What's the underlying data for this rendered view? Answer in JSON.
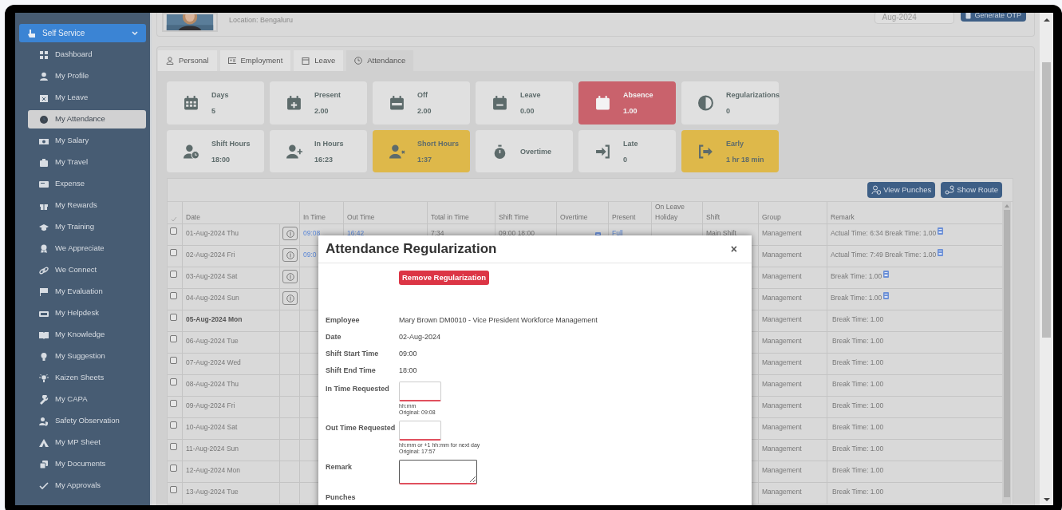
{
  "sidebar": {
    "section": {
      "label": "Self Service",
      "expanded": true
    },
    "items": [
      {
        "label": "Dashboard",
        "selected": false
      },
      {
        "label": "My Profile",
        "selected": false
      },
      {
        "label": "My Leave",
        "selected": false
      },
      {
        "label": "My Attendance",
        "selected": true
      },
      {
        "label": "My Salary",
        "selected": false
      },
      {
        "label": "My Travel",
        "selected": false
      },
      {
        "label": "Expense",
        "selected": false
      },
      {
        "label": "My Rewards",
        "selected": false
      },
      {
        "label": "My Training",
        "selected": false
      },
      {
        "label": "We Appreciate",
        "selected": false
      },
      {
        "label": "We Connect",
        "selected": false
      },
      {
        "label": "My Evaluation",
        "selected": false
      },
      {
        "label": "My Helpdesk",
        "selected": false
      },
      {
        "label": "My Knowledge",
        "selected": false
      },
      {
        "label": "My Suggestion",
        "selected": false
      },
      {
        "label": "Kaizen Sheets",
        "selected": false
      },
      {
        "label": "My CAPA",
        "selected": false
      },
      {
        "label": "Safety Observation",
        "selected": false
      },
      {
        "label": "My MP Sheet",
        "selected": false
      },
      {
        "label": "My Documents",
        "selected": false
      },
      {
        "label": "My Approvals",
        "selected": false
      }
    ]
  },
  "profile": {
    "location": "Location: Bengaluru",
    "month": "Aug-2024",
    "otp_button": "Generate OTP"
  },
  "tabs": [
    {
      "label": "Personal",
      "selected": false
    },
    {
      "label": "Employment",
      "selected": false
    },
    {
      "label": "Leave",
      "selected": false
    },
    {
      "label": "Attendance",
      "selected": true
    }
  ],
  "stats": [
    {
      "label": "Days",
      "value": "5",
      "color": "#e0e0e0"
    },
    {
      "label": "Present",
      "value": "2.00",
      "color": "#e0e0e0"
    },
    {
      "label": "Off",
      "value": "2.00",
      "color": "#e0e0e0"
    },
    {
      "label": "Leave",
      "value": "0.00",
      "color": "#e0e0e0"
    },
    {
      "label": "Absence",
      "value": "1.00",
      "color": "#c9626c"
    },
    {
      "label": "Regularizations",
      "value": "0",
      "color": "#e0e0e0"
    },
    {
      "label": "Shift Hours",
      "value": "18:00",
      "color": "#e0e0e0"
    },
    {
      "label": "In Hours",
      "value": "16:23",
      "color": "#e0e0e0"
    },
    {
      "label": "Short Hours",
      "value": "1:37",
      "color": "#deb84a"
    },
    {
      "label": "Overtime",
      "color": "#e0e0e0"
    },
    {
      "label": "Late",
      "value": "0",
      "color": "#e0e0e0"
    },
    {
      "label": "Early",
      "value": "1 hr 18 min",
      "color": "#deb84a"
    }
  ],
  "toolbar": [
    "View Punches",
    "Show Route"
  ],
  "table": {
    "columns": [
      "Date",
      "In Time",
      "Out Time",
      "Total in Time",
      "Shift Time",
      "Overtime",
      "Present",
      "On Leave Holiday",
      "Shift",
      "Group",
      "Remark"
    ],
    "rows": [
      {
        "checked": false,
        "date": "01-Aug-2024 Thu",
        "bold": false,
        "info": true,
        "in_time": "09:08",
        "out_time": "16:42",
        "total": "7:34",
        "shift_time": "09:00 18:00",
        "overtime_icon": true,
        "present": "Full",
        "shift": "Main Shift",
        "group": "Management",
        "remark": "Actual Time: 6:34 Break Time: 1.00",
        "remark_icon": true
      },
      {
        "checked": false,
        "date": "02-Aug-2024 Fri",
        "bold": false,
        "info": true,
        "in_time": "09:0",
        "group": "Management",
        "remark": "Actual Time: 7:49 Break Time: 1.00",
        "remark_icon": true
      },
      {
        "checked": false,
        "date": "03-Aug-2024 Sat",
        "bold": false,
        "info": true,
        "group": "Management",
        "remark": "Break Time: 1.00",
        "remark_icon": true
      },
      {
        "checked": false,
        "date": "04-Aug-2024 Sun",
        "bold": false,
        "info": true,
        "group": "Management",
        "remark": "Break Time: 1.00",
        "remark_icon": true
      },
      {
        "checked": false,
        "date": "05-Aug-2024 Mon",
        "bold": true,
        "info": false,
        "group": "Management",
        "remark": "Break Time: 1.00",
        "remark_icon": false
      },
      {
        "checked": false,
        "date": "06-Aug-2024 Tue",
        "bold": false,
        "info": false,
        "group": "Management",
        "remark": "Break Time: 1.00",
        "remark_icon": false
      },
      {
        "checked": false,
        "date": "07-Aug-2024 Wed",
        "bold": false,
        "info": false,
        "group": "Management",
        "remark": "Break Time: 1.00",
        "remark_icon": false
      },
      {
        "checked": false,
        "date": "08-Aug-2024 Thu",
        "bold": false,
        "info": false,
        "group": "Management",
        "remark": "Break Time: 1.00",
        "remark_icon": false
      },
      {
        "checked": false,
        "date": "09-Aug-2024 Fri",
        "bold": false,
        "info": false,
        "group": "Management",
        "remark": "Break Time: 1.00",
        "remark_icon": false
      },
      {
        "checked": false,
        "date": "10-Aug-2024 Sat",
        "bold": false,
        "info": false,
        "group": "Management",
        "remark": "Break Time: 1.00",
        "remark_icon": false
      },
      {
        "checked": false,
        "date": "11-Aug-2024 Sun",
        "bold": false,
        "info": false,
        "group": "Management",
        "remark": "Break Time: 1.00",
        "remark_icon": false
      },
      {
        "checked": false,
        "date": "12-Aug-2024 Mon",
        "bold": false,
        "info": false,
        "group": "Management",
        "remark": "Break Time: 1.00",
        "remark_icon": false
      },
      {
        "checked": false,
        "date": "13-Aug-2024 Tue",
        "bold": false,
        "info": false,
        "group": "Management",
        "remark": "Break Time: 1.00",
        "remark_icon": false
      }
    ]
  },
  "modal": {
    "title": "Attendance Regularization",
    "close": "×",
    "remove_button": "Remove Regularization",
    "fields": [
      {
        "kind": "text",
        "label": "Employee",
        "value": "Mary Brown DM0010 - Vice President Workforce Management"
      },
      {
        "kind": "text",
        "label": "Date",
        "value": "02-Aug-2024"
      },
      {
        "kind": "text",
        "label": "Shift Start Time",
        "value": "09:00"
      },
      {
        "kind": "text",
        "label": "Shift End Time",
        "value": "18:00"
      },
      {
        "kind": "input",
        "label": "In Time Requested",
        "hints": [
          "hh:mm",
          "Original: 09:08"
        ]
      },
      {
        "kind": "input",
        "label": "Out Time Requested",
        "hints": [
          "hh:mm or +1 hh:mm for next day",
          "Original: 17:57"
        ]
      },
      {
        "kind": "textarea",
        "label": "Remark"
      },
      {
        "kind": "heading",
        "label": "Punches"
      }
    ]
  }
}
